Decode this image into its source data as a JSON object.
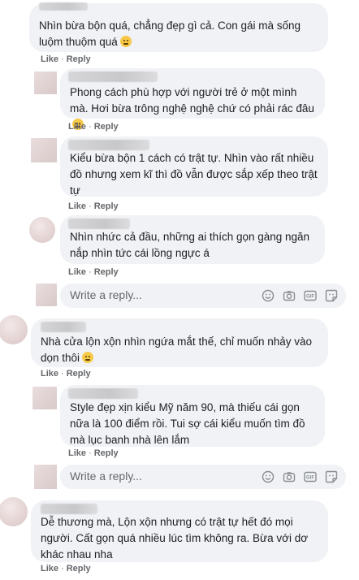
{
  "comments": [
    {
      "text": "Nhìn bừa bộn quá, chẳng đẹp gì cả. Con gái mà sống luộm thuộm quá",
      "emoji": true
    },
    {
      "text": "Phong cách phù hợp với người trẻ ở một mình mà. Hơi bừa trông nghệ nghệ chứ có phải rác đâu",
      "emoji": true
    },
    {
      "text": "Kiểu bừa bộn 1 cách có trật tự. Nhìn vào rất nhiều đồ nhưng xem kĩ thì đồ vẫn được sắp xếp theo trật tự",
      "emoji": false
    },
    {
      "text": "Nhìn nhức cả đầu, những ai thích gọn gàng ngăn nắp nhìn tức cái lồng ngực á",
      "emoji": false
    },
    {
      "text": "Nhà cửa lộn xộn nhìn ngứa mắt thế, chỉ muốn nhảy vào dọn thôi",
      "emoji": true
    },
    {
      "text": "Style đẹp xịn kiểu Mỹ năm 90, mà thiếu cái gọn nữa là 100 điểm rồi. Tui sợ cái kiểu muốn tìm đồ mà lục banh nhà lên lắm",
      "emoji": false
    },
    {
      "text": "Dễ thương mà, Lộn xộn nhưng có trật tự hết đó mọi người. Cất gọn quá nhiều lúc tìm không ra. Bừa với dơ khác nhau nha",
      "emoji": false
    }
  ],
  "actions": {
    "like": "Like",
    "reply": "Reply",
    "separator": "·"
  },
  "reply_box": {
    "placeholder": "Write a reply...",
    "icons": [
      "emoji-icon",
      "camera-icon",
      "gif-icon",
      "sticker-icon"
    ]
  },
  "colors": {
    "bubble": "#f0f2f5",
    "text": "#1c1e21",
    "meta": "#65676b"
  }
}
